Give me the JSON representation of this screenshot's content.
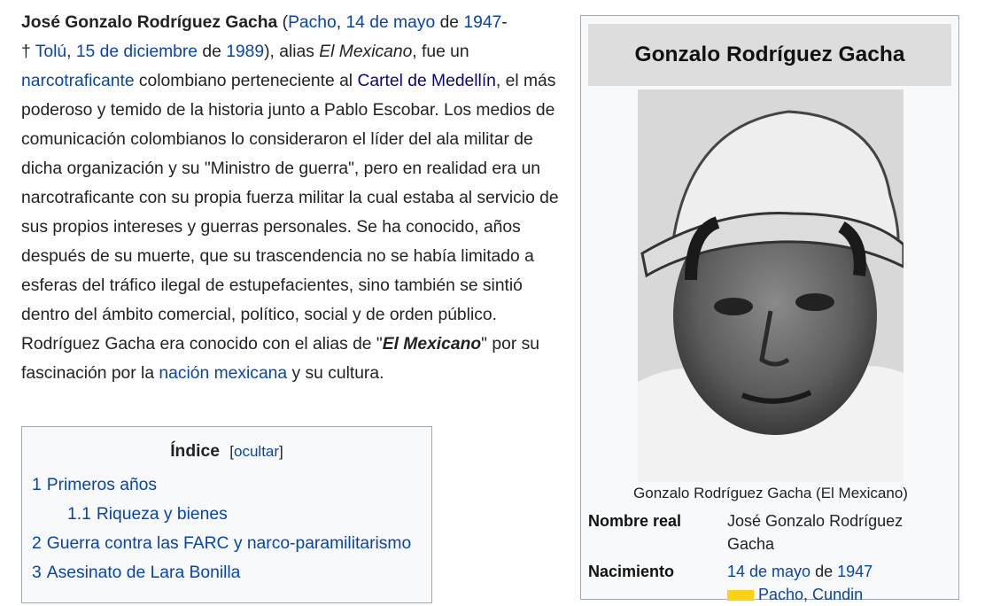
{
  "article": {
    "name_bold": "José Gonzalo Rodríguez Gacha",
    "birth_open": " (",
    "birth_place": "Pacho",
    "comma1": ", ",
    "birth_daymonth": "14 de mayo",
    "de1": " de ",
    "birth_year": "1947",
    "dash": "-",
    "death_cross": "† ",
    "death_place": "Tolú",
    "comma2": ", ",
    "death_daymonth": "15 de diciembre",
    "de2": " de ",
    "death_year": "1989",
    "alias_pre": "), alias ",
    "alias_italic": "El Mexicano",
    "fue_un": ", fue un ",
    "narco_link": "narcotraficante",
    "colombiano_text": " colombiano perteneciente al ",
    "cartel_link": "Cartel de Medellín",
    "body_text": ", el más poderoso y temido de la historia junto a Pablo Escobar. Los medios de comunicación colombianos lo consideraron el líder del ala militar de dicha organización y su \"Ministro de guerra\", pero en realidad era un narcotraficante con su propia fuerza militar la cual estaba al servicio de sus propios intereses y guerras personales. Se ha conocido, años después de su muerte, que su trascendencia no se había limitado a esferas del tráfico ilegal de estupefacientes, sino también se sintió dentro del ámbito comercial, político, social y de orden público. Rodríguez Gacha era conocido con el alias de \"",
    "el_mexicano_bi": "El Mexicano",
    "por_su": "\" por su fascinación por la ",
    "nacion_link": "nación mexicana",
    "ending": " y su cultura."
  },
  "toc": {
    "title": "Índice",
    "toggle_open": "[",
    "toggle_label": "ocultar",
    "toggle_close": "]",
    "items": [
      {
        "num": "1",
        "label": "Primeros años"
      },
      {
        "num": "1.1",
        "label": "Riqueza y bienes"
      },
      {
        "num": "2",
        "label": "Guerra contra las FARC y narco-paramilitarismo"
      },
      {
        "num": "3",
        "label": "Asesinato de Lara Bonilla"
      }
    ]
  },
  "infobox": {
    "title": "Gonzalo Rodríguez Gacha",
    "caption": "Gonzalo Rodríguez Gacha (El Mexicano)",
    "real_name_label": "Nombre real",
    "real_name_value": "José Gonzalo Rodríguez Gacha",
    "birth_label": "Nacimiento",
    "birth_daymonth": "14 de mayo",
    "birth_de": " de ",
    "birth_year": "1947",
    "birth_place_partial": "Pacho, Cundin"
  },
  "colors": {
    "link": "#0645ad",
    "visited": "#0b0080",
    "border": "#a2a9b1",
    "infobox_bg": "#f8f9fa",
    "title_bg": "#dddddd"
  }
}
